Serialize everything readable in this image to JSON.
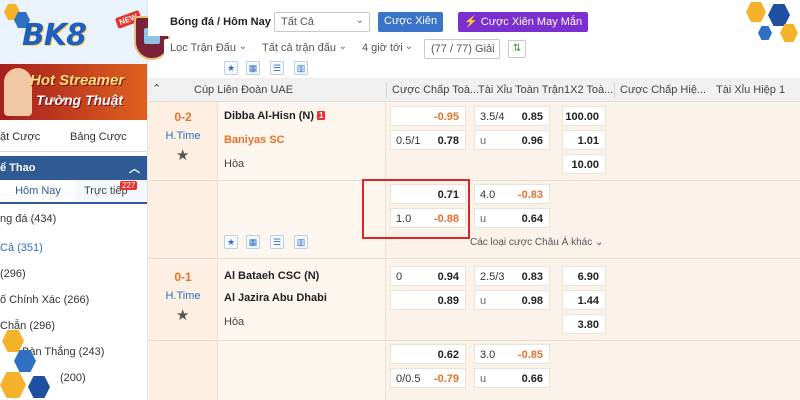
{
  "sidebar": {
    "brand": "BK8",
    "new_badge": "NEW",
    "promo_line1": "Hot Streamer",
    "promo_line2": "Tường Thuật",
    "tabs": {
      "bet_tab": "ặt Cược",
      "slip_tab": "Bảng Cược"
    },
    "sport_header": "ể Thao",
    "today_tab": "Hôm Nay",
    "live_tab": "Trực tiếp",
    "live_count": "227",
    "items": [
      {
        "label": "ng đá (434)"
      },
      {
        "label": "Cả (351)"
      },
      {
        "label": "(296)"
      },
      {
        "label": "ố Chính Xác (266)"
      },
      {
        "label": "Chẵn (296)"
      },
      {
        "label": "Bàn Thắng (243)"
      },
      {
        "label": "(200)"
      }
    ]
  },
  "topbar": {
    "breadcrumb": "Bóng đá / Hôm Nay",
    "filter_all": "Tất Cả",
    "parlay_button": "Cược Xiên",
    "lucky_parlay_button": "Cược Xiên May Mắn",
    "match_filter": "Lọc Trận Đấu",
    "all_matches": "Tất cả trận đấu",
    "time_filter": "4 giờ tới",
    "league_count": "(77 / 77) Giải"
  },
  "table": {
    "league": "Cúp Liên Đoàn UAE",
    "headers": [
      "Cược Chấp Toà...",
      "Tài Xỉu Toàn Trận",
      "1X2 Toà...",
      "Cược Chấp Hiệ...",
      "Tài Xỉu Hiệp 1"
    ],
    "more_link": "Các loại cược Châu Á khác",
    "draw_label": "Hòa",
    "matches": [
      {
        "score": "0-2",
        "period": "H.Time",
        "home": "Dibba Al-Hisn (N)",
        "home_red_cards": "1",
        "away": "Baniyas SC",
        "draw": "Hòa",
        "rows": [
          {
            "hdp_line": "",
            "hdp_val": "-0.95",
            "ou_line": "3.5/4",
            "ou_val": "0.85",
            "x12": "100.00"
          },
          {
            "hdp_line": "0.5/1",
            "hdp_val": "0.78",
            "ou_line": "u",
            "ou_val": "0.96",
            "x12": "1.01"
          },
          {
            "x12": "10.00"
          }
        ],
        "alt_rows": [
          {
            "hdp_line": "",
            "hdp_val": "0.71",
            "ou_line": "4.0",
            "ou_val": "-0.83"
          },
          {
            "hdp_line": "1.0",
            "hdp_val": "-0.88",
            "ou_line": "u",
            "ou_val": "0.64"
          }
        ]
      },
      {
        "score": "0-1",
        "period": "H.Time",
        "home": "Al Bataeh CSC (N)",
        "away": "Al Jazira Abu Dhabi",
        "draw": "Hòa",
        "rows": [
          {
            "hdp_line": "0",
            "hdp_val": "0.94",
            "ou_line": "2.5/3",
            "ou_val": "0.83",
            "x12": "6.90"
          },
          {
            "hdp_line": "",
            "hdp_val": "0.89",
            "ou_line": "u",
            "ou_val": "0.98",
            "x12": "1.44"
          },
          {
            "x12": "3.80"
          }
        ],
        "alt_rows": [
          {
            "hdp_line": "",
            "hdp_val": "0.62",
            "ou_line": "3.0",
            "ou_val": "-0.85"
          },
          {
            "hdp_line": "0/0.5",
            "hdp_val": "-0.79",
            "ou_line": "u",
            "ou_val": "0.66"
          }
        ]
      }
    ]
  },
  "colors": {
    "accent_blue": "#2f6fc4",
    "header_navy": "#2f5a93",
    "odds_orange": "#e8722b",
    "highlight_red": "#d9262a",
    "purple_button": "#7b2fd1"
  }
}
